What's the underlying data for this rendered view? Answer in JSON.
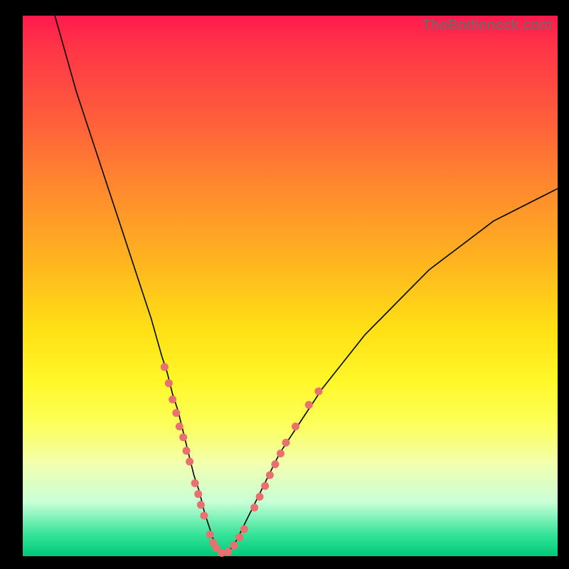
{
  "watermark": "TheBottleneck.com",
  "colors": {
    "background": "#000000",
    "gradient_top": "#ff1a4d",
    "gradient_bottom": "#00c97a",
    "curve": "#000000",
    "marker": "#e8706e"
  },
  "chart_data": {
    "type": "line",
    "title": "",
    "xlabel": "",
    "ylabel": "",
    "xlim": [
      0,
      100
    ],
    "ylim": [
      0,
      100
    ],
    "note": "No axis ticks or labels are drawn in the image. x is horizontal position percent (0 left → 100 right). y is the curve height as percent of plot height (0 at bottom → 100 at top). Curve is a V-shaped bottleneck dip; minimum ≈0 near x≈37. Markers are the salmon dots clustered on the lower portions of both arms.",
    "series": [
      {
        "name": "bottleneck-curve",
        "x": [
          6,
          8,
          10,
          12,
          14,
          16,
          18,
          20,
          22,
          24,
          26,
          27,
          28,
          29,
          30,
          31,
          32,
          33,
          34,
          35,
          36,
          37,
          38,
          39,
          40,
          41,
          42,
          43,
          44,
          46,
          48,
          50,
          52,
          54,
          56,
          60,
          64,
          68,
          72,
          76,
          80,
          84,
          88,
          92,
          96,
          100
        ],
        "y": [
          100,
          93,
          86,
          80,
          74,
          68,
          62,
          56,
          50,
          44,
          37,
          34,
          30,
          27,
          23,
          19,
          15,
          12,
          8,
          5,
          2,
          0.5,
          0.5,
          1.5,
          3,
          5,
          7,
          9,
          11,
          15,
          19,
          22,
          25,
          28,
          31,
          36,
          41,
          45,
          49,
          53,
          56,
          59,
          62,
          64,
          66,
          68
        ]
      }
    ],
    "markers": [
      {
        "x": 26.5,
        "y": 35
      },
      {
        "x": 27.3,
        "y": 32
      },
      {
        "x": 28.0,
        "y": 29
      },
      {
        "x": 28.7,
        "y": 26.5
      },
      {
        "x": 29.3,
        "y": 24
      },
      {
        "x": 30.0,
        "y": 22
      },
      {
        "x": 30.6,
        "y": 19.5
      },
      {
        "x": 31.2,
        "y": 17.5
      },
      {
        "x": 32.2,
        "y": 13.5
      },
      {
        "x": 32.8,
        "y": 11.5
      },
      {
        "x": 33.3,
        "y": 9.5
      },
      {
        "x": 33.9,
        "y": 7.5
      },
      {
        "x": 35.0,
        "y": 4
      },
      {
        "x": 35.6,
        "y": 2.5
      },
      {
        "x": 36.2,
        "y": 1.5
      },
      {
        "x": 37.2,
        "y": 0.6
      },
      {
        "x": 38.4,
        "y": 0.8
      },
      {
        "x": 39.5,
        "y": 2
      },
      {
        "x": 40.5,
        "y": 3.5
      },
      {
        "x": 41.4,
        "y": 5
      },
      {
        "x": 43.3,
        "y": 9
      },
      {
        "x": 44.3,
        "y": 11
      },
      {
        "x": 45.3,
        "y": 13
      },
      {
        "x": 46.2,
        "y": 15
      },
      {
        "x": 47.2,
        "y": 17
      },
      {
        "x": 48.2,
        "y": 19
      },
      {
        "x": 49.2,
        "y": 21
      },
      {
        "x": 51.0,
        "y": 24
      },
      {
        "x": 53.5,
        "y": 28
      },
      {
        "x": 55.3,
        "y": 30.5
      }
    ]
  }
}
